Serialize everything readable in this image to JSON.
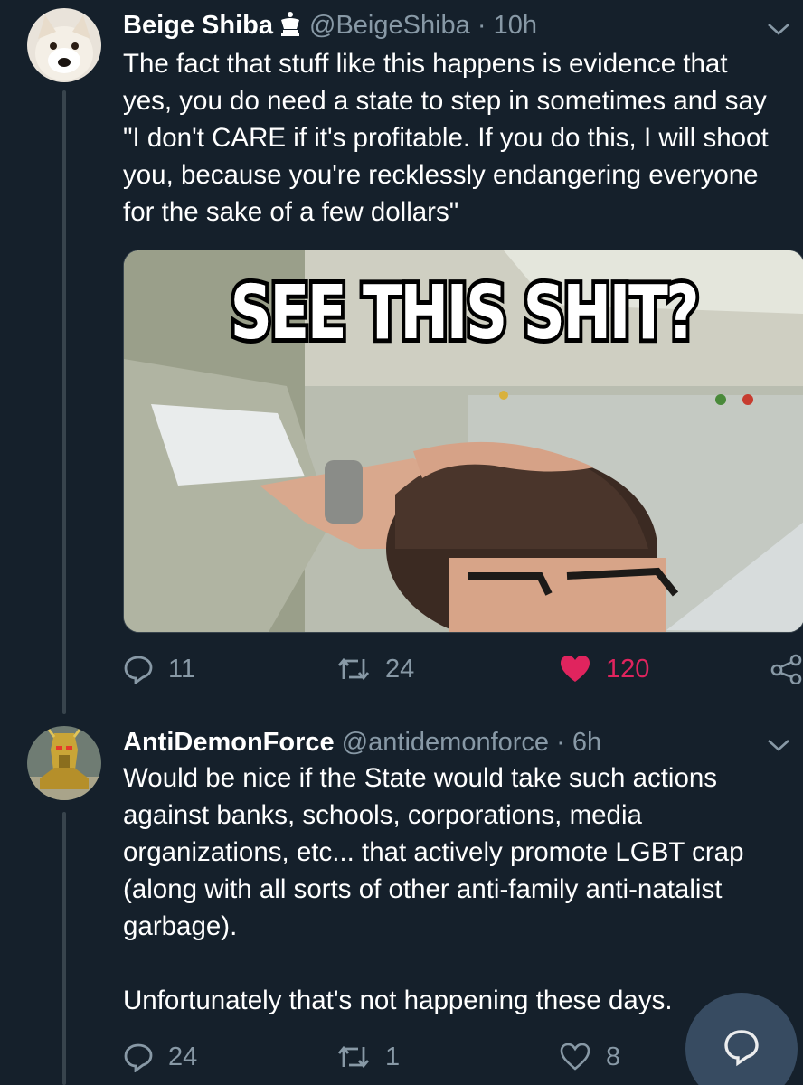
{
  "tweets": [
    {
      "display_name": "Beige Shiba",
      "handle": "@BeigeShiba",
      "separator": "·",
      "time": "10h",
      "badge_icon": "crown-icon",
      "text": "The fact that stuff like this happens is evidence that\nyes, you do need a state to step in sometimes and say\n\"I don't CARE if it's profitable. If you do this, I will shoot\nyou, because you're recklessly endangering everyone\nfor the sake of a few dollars\"",
      "media_caption": "SEE THIS SHIT?",
      "replies": "11",
      "retweets": "24",
      "likes": "120",
      "liked": true
    },
    {
      "display_name": "AntiDemonForce",
      "handle": "@antidemonforce",
      "separator": "·",
      "time": "6h",
      "text": "Would be nice if the State would take such actions\nagainst banks, schools, corporations, media\norganizations, etc... that actively promote LGBT crap\n(along with all sorts of other anti-family anti-natalist\ngarbage).\n\nUnfortunately that's not happening these days.",
      "replies": "24",
      "retweets": "1",
      "likes": "8",
      "liked": false
    }
  ],
  "colors": {
    "background": "#15202b",
    "secondary_text": "#8899a6",
    "like_active": "#e0245e",
    "thread_line": "#38444d",
    "fab": "#3a4f66"
  },
  "fab_icon": "compose-reply-icon"
}
